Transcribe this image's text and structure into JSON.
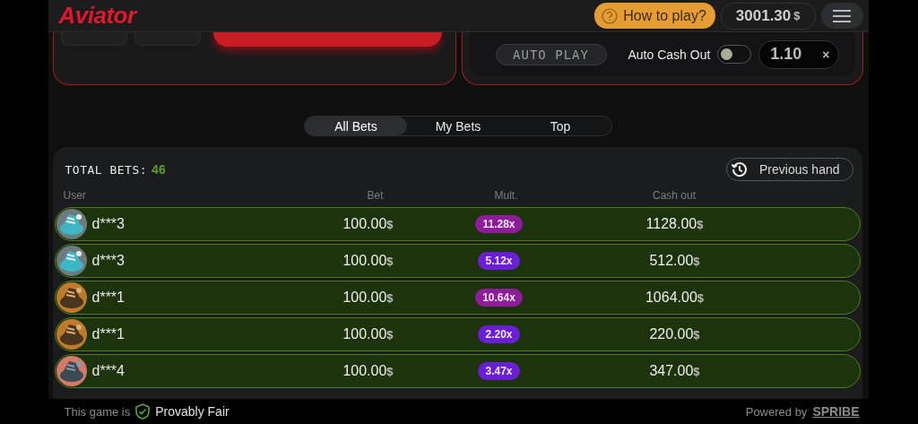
{
  "header": {
    "logo": "Aviator",
    "help_button": "How to play?",
    "balance": "3001.30",
    "currency": "$"
  },
  "auto_panel": {
    "auto_play": "AUTO PLAY",
    "auto_cash_out": "Auto Cash Out",
    "auto_cash_out_on": false,
    "cash_out_value": "1.10",
    "clear": "×"
  },
  "tabs": [
    {
      "label": "All Bets",
      "selected": true
    },
    {
      "label": "My Bets",
      "selected": false
    },
    {
      "label": "Top",
      "selected": false
    }
  ],
  "bets": {
    "total_label": "TOTAL BETS:",
    "total": "46",
    "previous_hand": "Previous hand",
    "columns": [
      "User",
      "Bet",
      "Mult.",
      "Cash out"
    ],
    "rows": [
      {
        "user": "d***3",
        "bet": "100.00",
        "currency": "$",
        "mult": "11.28x",
        "color": "#8e1c9b",
        "cash_out": "1128.00",
        "cash_currency": "$",
        "cashed": true
      },
      {
        "user": "d***3",
        "bet": "100.00",
        "currency": "$",
        "mult": "5.12x",
        "color": "#6a1fd6",
        "cash_out": "512.00",
        "cash_currency": "$",
        "cashed": true
      },
      {
        "user": "d***1",
        "bet": "100.00",
        "currency": "$",
        "mult": "10.64x",
        "color": "#8e1c9b",
        "cash_out": "1064.00",
        "cash_currency": "$",
        "cashed": true
      },
      {
        "user": "d***1",
        "bet": "100.00",
        "currency": "$",
        "mult": "2.20x",
        "color": "#6a1fd6",
        "cash_out": "220.00",
        "cash_currency": "$",
        "cashed": true
      },
      {
        "user": "d***4",
        "bet": "100.00",
        "currency": "$",
        "mult": "3.47x",
        "color": "#6a1fd6",
        "cash_out": "347.00",
        "cash_currency": "$",
        "cashed": true
      }
    ]
  },
  "footer": {
    "fair_prefix": "This game is",
    "fair_label": "Provably Fair",
    "powered_by": "Powered by",
    "brand": "SPRIBE"
  }
}
